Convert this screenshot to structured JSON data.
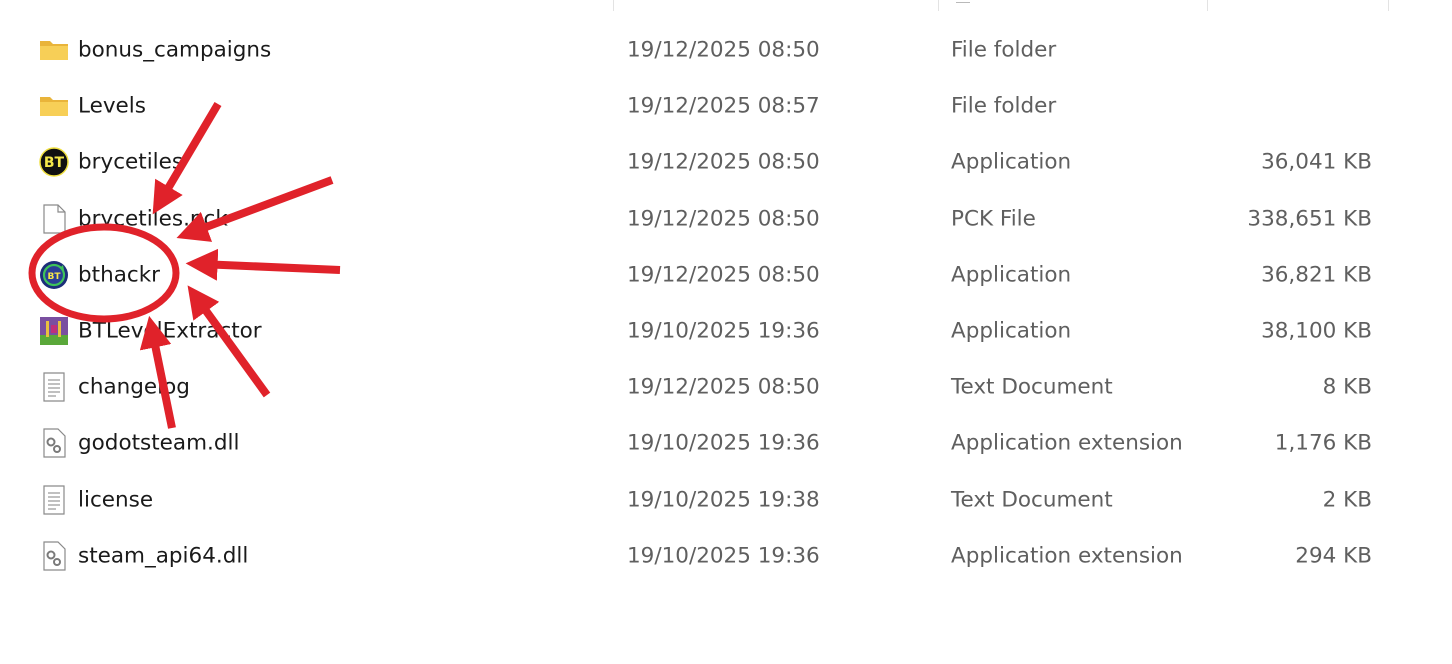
{
  "files": [
    {
      "name": "bonus_campaigns",
      "date": "19/12/2025 08:50",
      "type": "File folder",
      "size": "",
      "icon": "folder-icon"
    },
    {
      "name": "Levels",
      "date": "19/12/2025 08:57",
      "type": "File folder",
      "size": "",
      "icon": "folder-icon"
    },
    {
      "name": "brycetiles",
      "date": "19/12/2025 08:50",
      "type": "Application",
      "size": "36,041 KB",
      "icon": "brycetiles-app-icon"
    },
    {
      "name": "brycetiles.pck",
      "date": "19/12/2025 08:50",
      "type": "PCK File",
      "size": "338,651 KB",
      "icon": "blank-file-icon"
    },
    {
      "name": "bthackr",
      "date": "19/12/2025 08:50",
      "type": "Application",
      "size": "36,821 KB",
      "icon": "bthackr-app-icon"
    },
    {
      "name": "BTLevelExtractor",
      "date": "19/10/2025 19:36",
      "type": "Application",
      "size": "38,100 KB",
      "icon": "extractor-app-icon"
    },
    {
      "name": "changelog",
      "date": "19/12/2025 08:50",
      "type": "Text Document",
      "size": "8 KB",
      "icon": "text-document-icon"
    },
    {
      "name": "godotsteam.dll",
      "date": "19/10/2025 19:36",
      "type": "Application extension",
      "size": "1,176 KB",
      "icon": "dll-gear-icon"
    },
    {
      "name": "license",
      "date": "19/10/2025 19:38",
      "type": "Text Document",
      "size": "2 KB",
      "icon": "text-document-icon"
    },
    {
      "name": "steam_api64.dll",
      "date": "19/10/2025 19:36",
      "type": "Application extension",
      "size": "294 KB",
      "icon": "dll-gear-icon"
    }
  ],
  "annotation": {
    "highlight_color": "#e0222a",
    "highlighted_item": "bthackr"
  },
  "colors": {
    "folder": "#f4c64e",
    "name_text": "#1a1a1a",
    "meta_text": "#5f5f5f"
  }
}
